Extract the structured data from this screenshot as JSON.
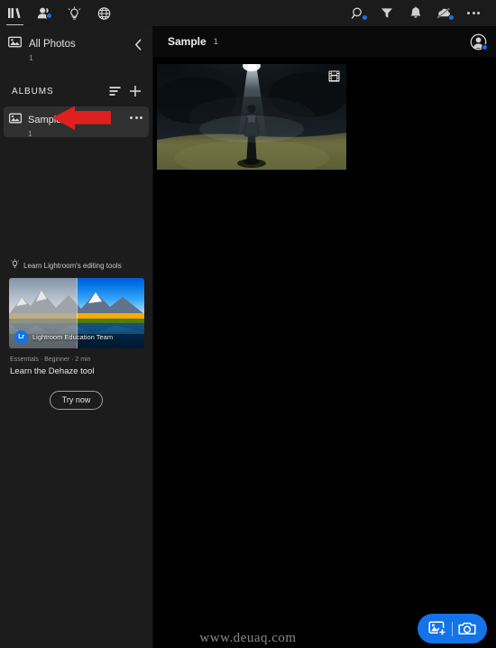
{
  "app": {
    "accent_color": "#1473e6",
    "sidebar_bg": "#1c1c1c",
    "main_bg": "#000000",
    "annotation_color": "#e01f1f"
  },
  "topbar": {
    "left_icons": [
      {
        "name": "library-icon",
        "label": "Library",
        "active": true,
        "badge": false
      },
      {
        "name": "shared-people-icon",
        "label": "Shared",
        "active": false,
        "badge": true
      },
      {
        "name": "lightbulb-icon",
        "label": "Discover",
        "active": false,
        "badge": false
      },
      {
        "name": "globe-icon",
        "label": "Community",
        "active": false,
        "badge": false
      }
    ],
    "right_icons": [
      {
        "name": "search-icon",
        "label": "Search",
        "badge": true
      },
      {
        "name": "filter-icon",
        "label": "Filter",
        "badge": false
      },
      {
        "name": "bell-icon",
        "label": "Notifications",
        "badge": false
      },
      {
        "name": "sync-off-icon",
        "label": "Sync paused",
        "badge": true
      },
      {
        "name": "more-options-icon",
        "label": "More options",
        "badge": false
      }
    ]
  },
  "sidebar": {
    "all_photos": {
      "label": "All Photos",
      "count": "1",
      "icon": "photo-icon"
    },
    "collapse_icon": "chevron-left-icon",
    "albums_section": {
      "title": "ALBUMS",
      "sort_icon": "sort-icon",
      "add_icon": "plus-icon"
    },
    "albums": [
      {
        "label": "Sample",
        "count": "1",
        "icon": "album-icon",
        "menu_icon": "more-options-icon",
        "selected": true
      }
    ],
    "learn_card": {
      "header_label": "Learn Lightroom's editing tools",
      "header_icon": "lightbulb-icon",
      "byline_avatar": "Lr",
      "byline_name": "Lightroom Education Team",
      "meta": "Essentials · Beginner · 2 min",
      "title": "Learn the Dehaze tool",
      "cta_label": "Try now"
    }
  },
  "main": {
    "title": "Sample",
    "count": "1",
    "avatar_icon": "user-avatar-icon",
    "photos": [
      {
        "alt": "Person standing on a grassy field in a beam of light with fog",
        "is_video": true,
        "badge_icon": "film-strip-icon"
      }
    ]
  },
  "fab": {
    "add_photos_icon": "add-photos-icon",
    "camera_icon": "camera-icon"
  },
  "watermark": {
    "text": "www.deuaq.com"
  }
}
